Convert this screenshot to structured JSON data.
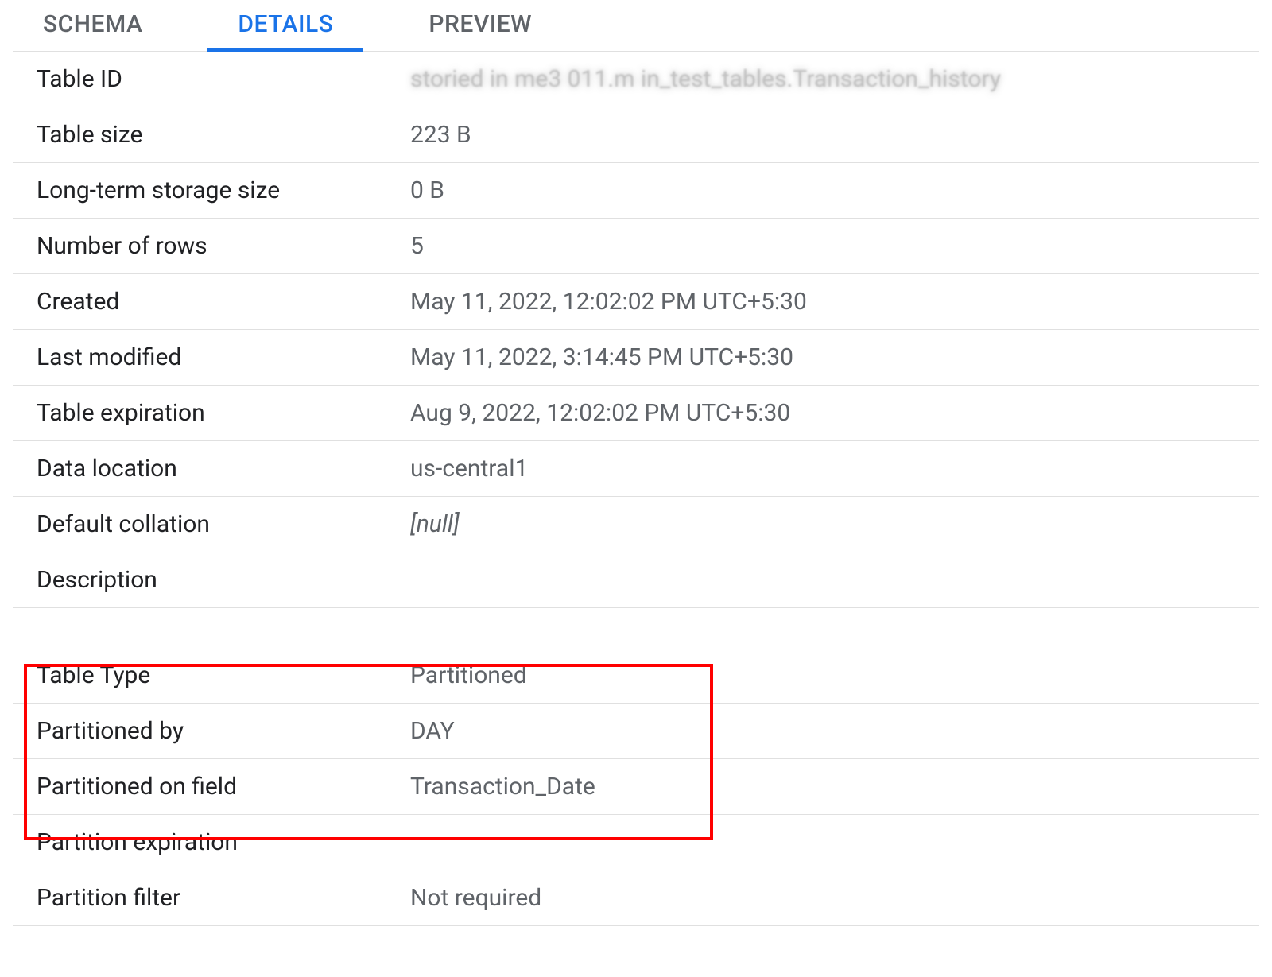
{
  "tabs": {
    "schema": "SCHEMA",
    "details": "DETAILS",
    "preview": "PREVIEW"
  },
  "details": {
    "rows": [
      {
        "label": "Table ID",
        "value": "storied in    me3  011.m  in_test_tables.Transaction_history",
        "blurred": true
      },
      {
        "label": "Table size",
        "value": "223 B"
      },
      {
        "label": "Long-term storage size",
        "value": "0 B"
      },
      {
        "label": "Number of rows",
        "value": "5"
      },
      {
        "label": "Created",
        "value": "May 11, 2022, 12:02:02 PM UTC+5:30"
      },
      {
        "label": "Last modified",
        "value": "May 11, 2022, 3:14:45 PM UTC+5:30"
      },
      {
        "label": "Table expiration",
        "value": "Aug 9, 2022, 12:02:02 PM UTC+5:30"
      },
      {
        "label": "Data location",
        "value": "us-central1"
      },
      {
        "label": "Default collation",
        "value": "[null]",
        "italic": true
      },
      {
        "label": "Description",
        "value": ""
      }
    ],
    "partition_rows": [
      {
        "label": "Table Type",
        "value": "Partitioned"
      },
      {
        "label": "Partitioned by",
        "value": "DAY"
      },
      {
        "label": "Partitioned on field",
        "value": "Transaction_Date"
      },
      {
        "label": "Partition expiration",
        "value": ""
      },
      {
        "label": "Partition filter",
        "value": "Not required"
      }
    ]
  }
}
